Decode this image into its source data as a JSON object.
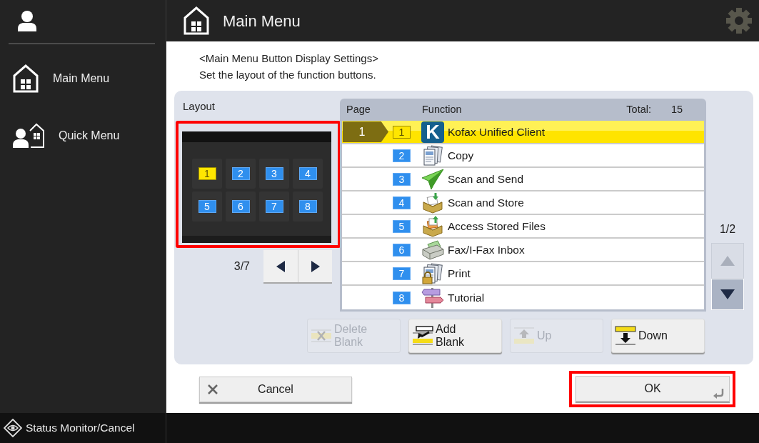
{
  "sidebar": {
    "items": [
      {
        "kind": "main-menu",
        "label": "Main Menu"
      },
      {
        "kind": "quick-menu",
        "label": "Quick Menu"
      }
    ]
  },
  "header": {
    "title": "Main Menu",
    "settings_disabled": true
  },
  "instructions": [
    "<Main Menu Button Display Settings>",
    "Set the layout of the function buttons."
  ],
  "layout": {
    "label": "Layout",
    "highlighted": true,
    "slots": [
      {
        "number": "1",
        "selected": true
      },
      {
        "number": "2",
        "selected": false
      },
      {
        "number": "3",
        "selected": false
      },
      {
        "number": "4",
        "selected": false
      },
      {
        "number": "5",
        "selected": false
      },
      {
        "number": "6",
        "selected": false
      },
      {
        "number": "7",
        "selected": false
      },
      {
        "number": "8",
        "selected": false
      }
    ],
    "page": "3/7"
  },
  "table": {
    "columns": [
      "Page",
      "Function"
    ],
    "total_label": "Total:",
    "total": "15",
    "rows": [
      {
        "page": "1",
        "number": "1",
        "kind": "logo",
        "logo_text": "K",
        "label": "Kofax Unified Client",
        "selected": true
      },
      {
        "number": "2",
        "kind": "copy",
        "label": "Copy",
        "selected": false
      },
      {
        "number": "3",
        "kind": "send",
        "label": "Scan and Send",
        "selected": false
      },
      {
        "number": "4",
        "kind": "store",
        "label": "Scan and Store",
        "selected": false
      },
      {
        "number": "5",
        "kind": "access",
        "label": "Access Stored Files",
        "selected": false
      },
      {
        "number": "6",
        "kind": "fax",
        "label": "Fax/I-Fax Inbox",
        "selected": false
      },
      {
        "number": "7",
        "kind": "print",
        "label": "Print",
        "selected": false
      },
      {
        "number": "8",
        "kind": "tutorial",
        "label": "Tutorial",
        "selected": false
      }
    ]
  },
  "scroll": {
    "page": "1/2",
    "up_disabled": true,
    "down_disabled": false
  },
  "actions": [
    {
      "kind": "delete-blank",
      "label": "Delete Blank",
      "disabled": true
    },
    {
      "kind": "add-blank",
      "label": "Add Blank",
      "disabled": false
    },
    {
      "kind": "up",
      "label": "Up",
      "disabled": true
    },
    {
      "kind": "down",
      "label": "Down",
      "disabled": false
    }
  ],
  "footer": {
    "cancel": "Cancel",
    "ok": "OK",
    "ok_highlighted": true
  },
  "status_bar": {
    "label": "Status Monitor/Cancel"
  }
}
